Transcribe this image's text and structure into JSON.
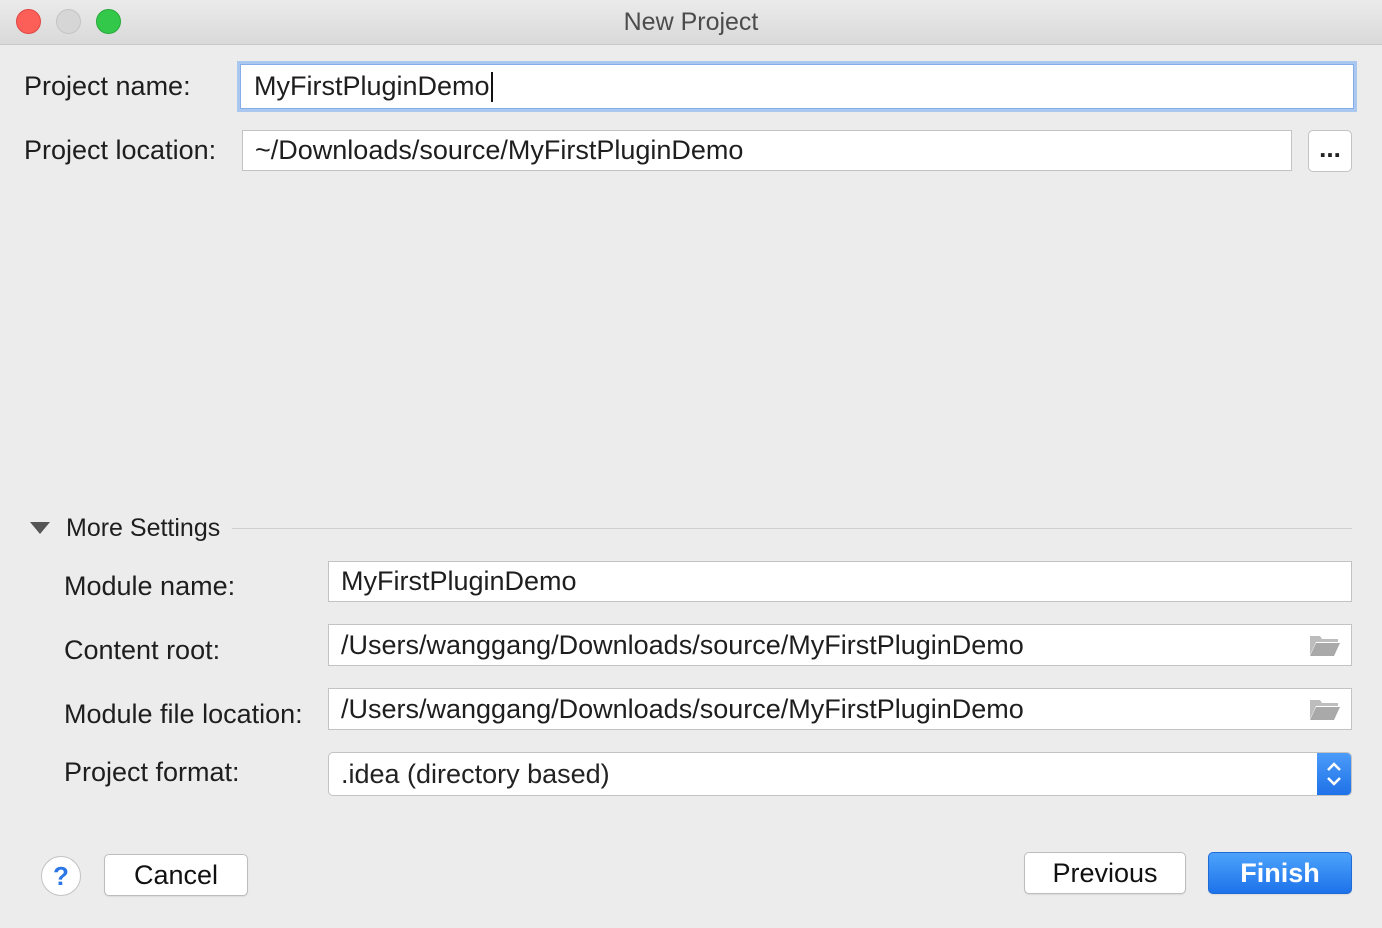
{
  "window": {
    "title": "New Project"
  },
  "form": {
    "project_name_label": "Project name:",
    "project_name_value": "MyFirstPluginDemo",
    "project_location_label": "Project location:",
    "project_location_value": "~/Downloads/source/MyFirstPluginDemo",
    "browse_label": "..."
  },
  "more_settings": {
    "section_label": "More Settings",
    "module_name_label": "Module name:",
    "module_name_value": "MyFirstPluginDemo",
    "content_root_label": "Content root:",
    "content_root_value": "/Users/wanggang/Downloads/source/MyFirstPluginDemo",
    "module_file_location_label": "Module file location:",
    "module_file_location_value": "/Users/wanggang/Downloads/source/MyFirstPluginDemo",
    "project_format_label": "Project format:",
    "project_format_value": ".idea (directory based)"
  },
  "footer": {
    "help_label": "?",
    "cancel_label": "Cancel",
    "previous_label": "Previous",
    "finish_label": "Finish"
  },
  "icons": {
    "folder": "folder-icon",
    "disclosure": "triangle-down-icon",
    "select_arrows": "chevron-up-down-icon"
  },
  "colors": {
    "accent": "#1d72ea",
    "focus_ring": "#a9c7ef",
    "window_bg": "#ececec"
  }
}
